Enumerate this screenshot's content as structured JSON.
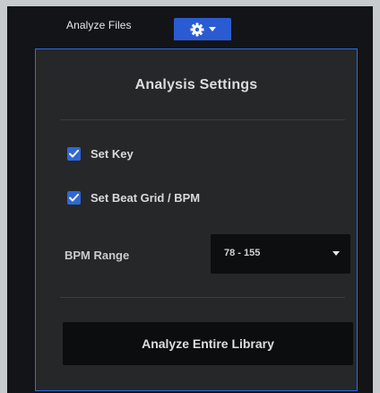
{
  "topbar": {
    "analyze_files_label": "Analyze Files",
    "settings_icon": "gear-icon",
    "dropdown_icon": "caret-down-icon"
  },
  "popup": {
    "title": "Analysis Settings",
    "options": [
      {
        "label": "Set Key",
        "checked": true
      },
      {
        "label": "Set Beat Grid / BPM",
        "checked": true
      }
    ],
    "bpm_range": {
      "label": "BPM Range",
      "value": "78 - 155"
    },
    "analyze_button_label": "Analyze Entire Library"
  },
  "colors": {
    "accent": "#2f68d6",
    "panel": "#262729",
    "background": "#131417"
  }
}
